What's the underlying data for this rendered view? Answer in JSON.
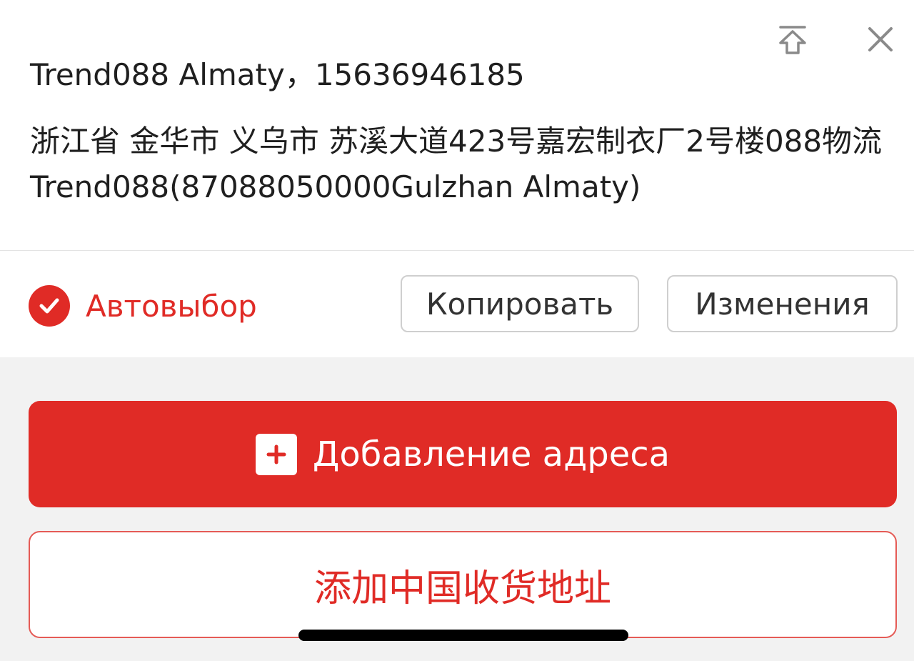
{
  "address_card": {
    "name_phone": "Trend088 Almaty，15636946185",
    "address": "浙江省 金华市 义乌市 苏溪大道423号嘉宏制衣厂2号楼088物流Trend088(87088050000Gulzhan Almaty)",
    "auto_select_label": "Автовыбор",
    "copy_label": "Копировать",
    "edit_label": "Изменения",
    "top_icons": [
      "pin-to-top-icon",
      "close-icon"
    ]
  },
  "actions": {
    "add_address_label": "Добавление адреса",
    "add_china_address_label": "添加中国收货地址"
  },
  "colors": {
    "accent": "#e02b26",
    "background": "#f2f2f2",
    "card": "#ffffff",
    "border": "#cfcfcf"
  }
}
